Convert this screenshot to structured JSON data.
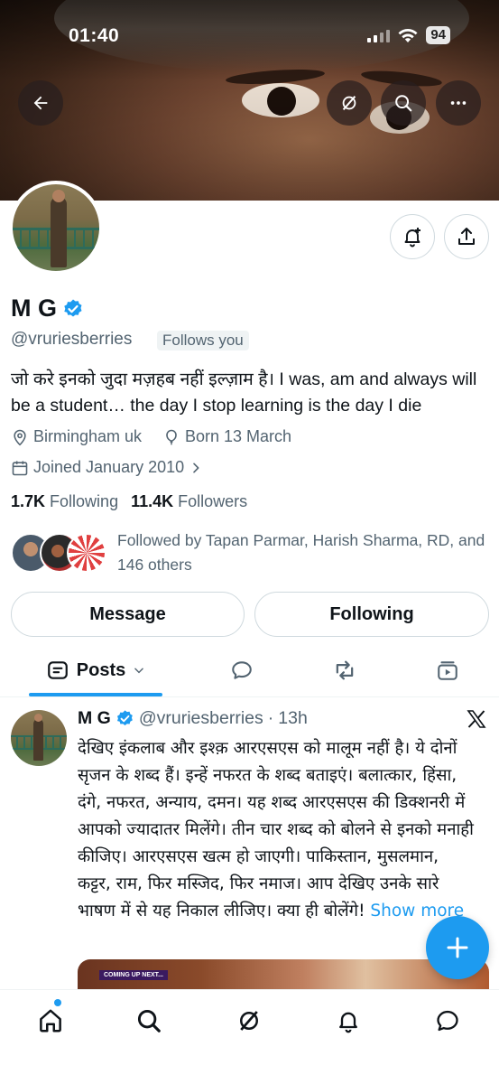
{
  "status_bar": {
    "time": "01:40",
    "battery": "94"
  },
  "profile": {
    "name": "M G",
    "handle": "@vruriesberries",
    "follows_you_badge": "Follows you",
    "bio": "जो करे इनको जुदा मज़हब नहीं इल्ज़ाम है। I was, am and always will be a student… the day I stop learning is the day I die",
    "location": "Birmingham uk",
    "birthday": "Born 13 March",
    "joined": "Joined January 2010",
    "following_count": "1.7K",
    "following_label": "Following",
    "followers_count": "11.4K",
    "followers_label": "Followers",
    "followed_by_text": "Followed by Tapan Parmar, Harish Sharma, RD, and 146 others"
  },
  "actions": {
    "message_label": "Message",
    "following_label": "Following"
  },
  "tabs": {
    "posts_label": "Posts"
  },
  "post": {
    "name": "M G",
    "handle": "@vruriesberries",
    "time": "13h",
    "separator": "·",
    "text": "देखिए इंकलाब और इश्क़ आरएसएस को मालूम नहीं है। ये दोनों सृजन के शब्द हैं। इन्हें नफरत के शब्द बताइएं। बलात्कार, हिंसा, दंगे, नफरत, अन्याय, दमन। यह शब्द आरएसएस की डिक्शनरी में आपको ज्यादातर मिलेंगे। तीन चार शब्द को बोलने से इनको मनाही कीजिए। आरएसएस खत्म हो जाएगी। पाकिस्तान, मुसलमान, कट्टर, राम, फिर मस्जिद, फिर नमाज। आप देखिए उनके सारे भाषण में से यह निकाल लीजिए। क्या ही बोलेंगे!",
    "show_more": "Show more",
    "media_badge": "COMING UP NEXT..."
  },
  "colors": {
    "accent": "#1d9bf0",
    "secondary_text": "#536471",
    "primary_text": "#0f1419"
  },
  "icons": {
    "back": "arrow-left-icon",
    "grok": "grok-icon",
    "search": "search-icon",
    "more": "more-horizontal-icon",
    "notify": "bell-plus-icon",
    "share": "share-icon",
    "verified": "verified-badge-icon",
    "location": "location-pin-icon",
    "birthday": "balloon-icon",
    "calendar": "calendar-icon",
    "x_logo": "x-logo-icon",
    "compose": "plus-icon"
  }
}
